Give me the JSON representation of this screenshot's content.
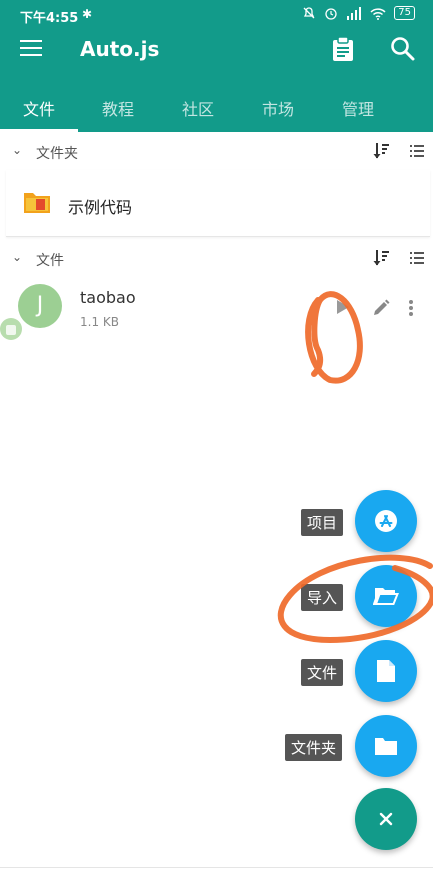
{
  "status_bar": {
    "time": "下午4:55",
    "battery": "75"
  },
  "app": {
    "title": "Auto.js",
    "accent": "#129b8a",
    "fab_color": "#19a8f0"
  },
  "tabs": [
    {
      "label": "文件",
      "active": true
    },
    {
      "label": "教程"
    },
    {
      "label": "社区"
    },
    {
      "label": "市场"
    },
    {
      "label": "管理"
    }
  ],
  "sections": {
    "folders": {
      "label": "文件夹"
    },
    "files": {
      "label": "文件"
    }
  },
  "folders": [
    {
      "name": "示例代码",
      "icon": "folder-icon"
    }
  ],
  "files": [
    {
      "name": "taobao",
      "size": "1.1 KB",
      "avatar_letter": "J"
    }
  ],
  "fab_menu": {
    "project": "项目",
    "import": "导入",
    "file": "文件",
    "folder": "文件夹"
  }
}
